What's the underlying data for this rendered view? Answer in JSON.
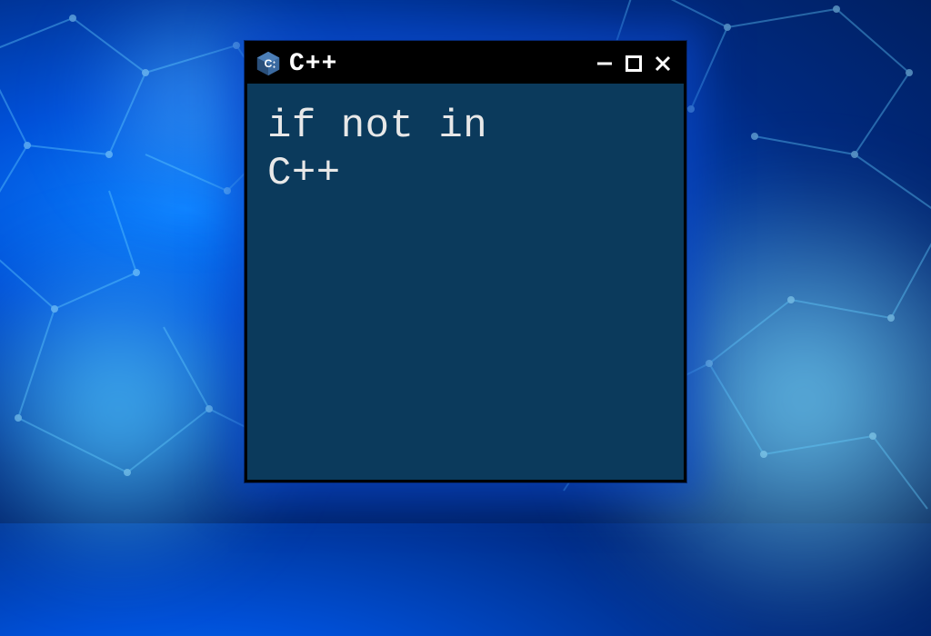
{
  "window": {
    "title": "C++",
    "icon_name": "cpp-logo-icon"
  },
  "content": {
    "line1": "if not in",
    "line2": "C++"
  },
  "colors": {
    "window_bg": "#0b3a5c",
    "titlebar_bg": "#000000",
    "text": "#e8e8e8",
    "icon_blue": "#3b6aa0"
  }
}
